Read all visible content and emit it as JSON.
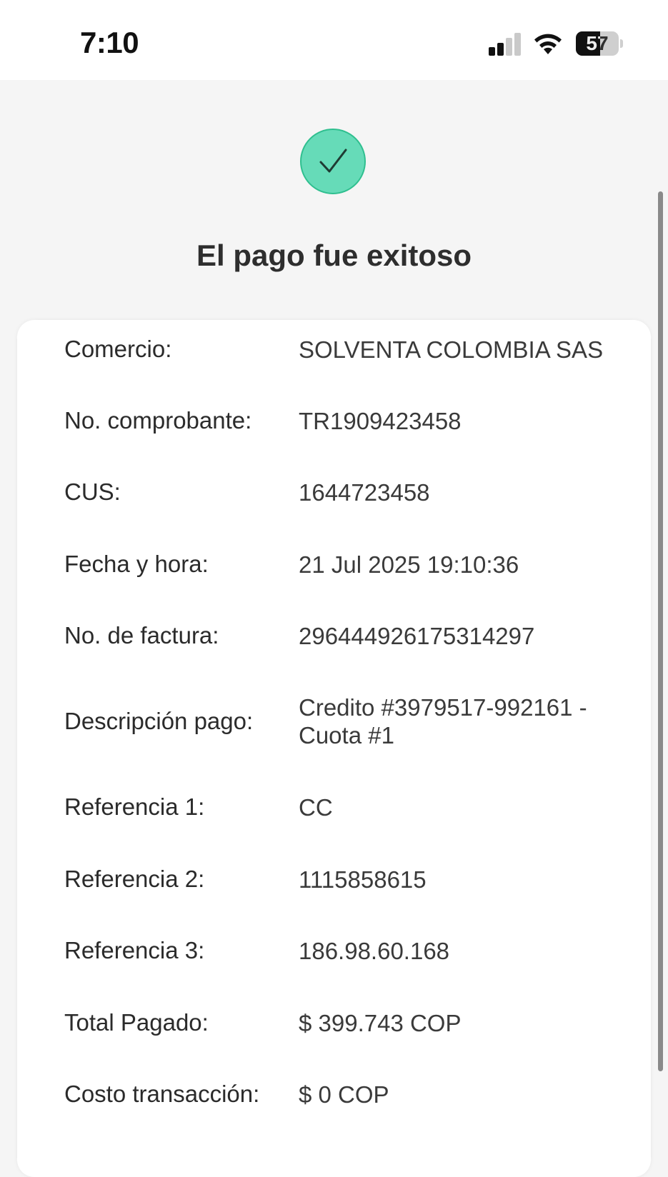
{
  "status_bar": {
    "time": "7:10",
    "battery_level": "57",
    "battery_fraction": 0.57,
    "signal_bars_active": 2,
    "signal_bars_total": 4
  },
  "header": {
    "success_icon": "checkmark-circle-icon",
    "title": "El pago fue exitoso"
  },
  "receipt": {
    "rows": [
      {
        "label": "Comercio:",
        "value": "SOLVENTA COLOMBIA SAS"
      },
      {
        "label": "No. comprobante:",
        "value": "TR1909423458"
      },
      {
        "label": "CUS:",
        "value": "1644723458"
      },
      {
        "label": "Fecha y hora:",
        "value": "21 Jul 2025 19:10:36"
      },
      {
        "label": "No. de factura:",
        "value": "296444926175314297"
      },
      {
        "label": "Descripción pago:",
        "value": "Credito #3979517-992161 - Cuota #1"
      },
      {
        "label": "Referencia 1:",
        "value": "CC"
      },
      {
        "label": "Referencia 2:",
        "value": "1115858615"
      },
      {
        "label": "Referencia 3:",
        "value": "186.98.60.168"
      },
      {
        "label": "Total Pagado:",
        "value": "$ 399.743 COP"
      },
      {
        "label": "Costo transacción:",
        "value": "$ 0 COP"
      }
    ]
  },
  "colors": {
    "success_fill": "#66dbb8",
    "success_border": "#2fbf8f",
    "background": "#f5f5f5",
    "card": "#ffffff"
  }
}
